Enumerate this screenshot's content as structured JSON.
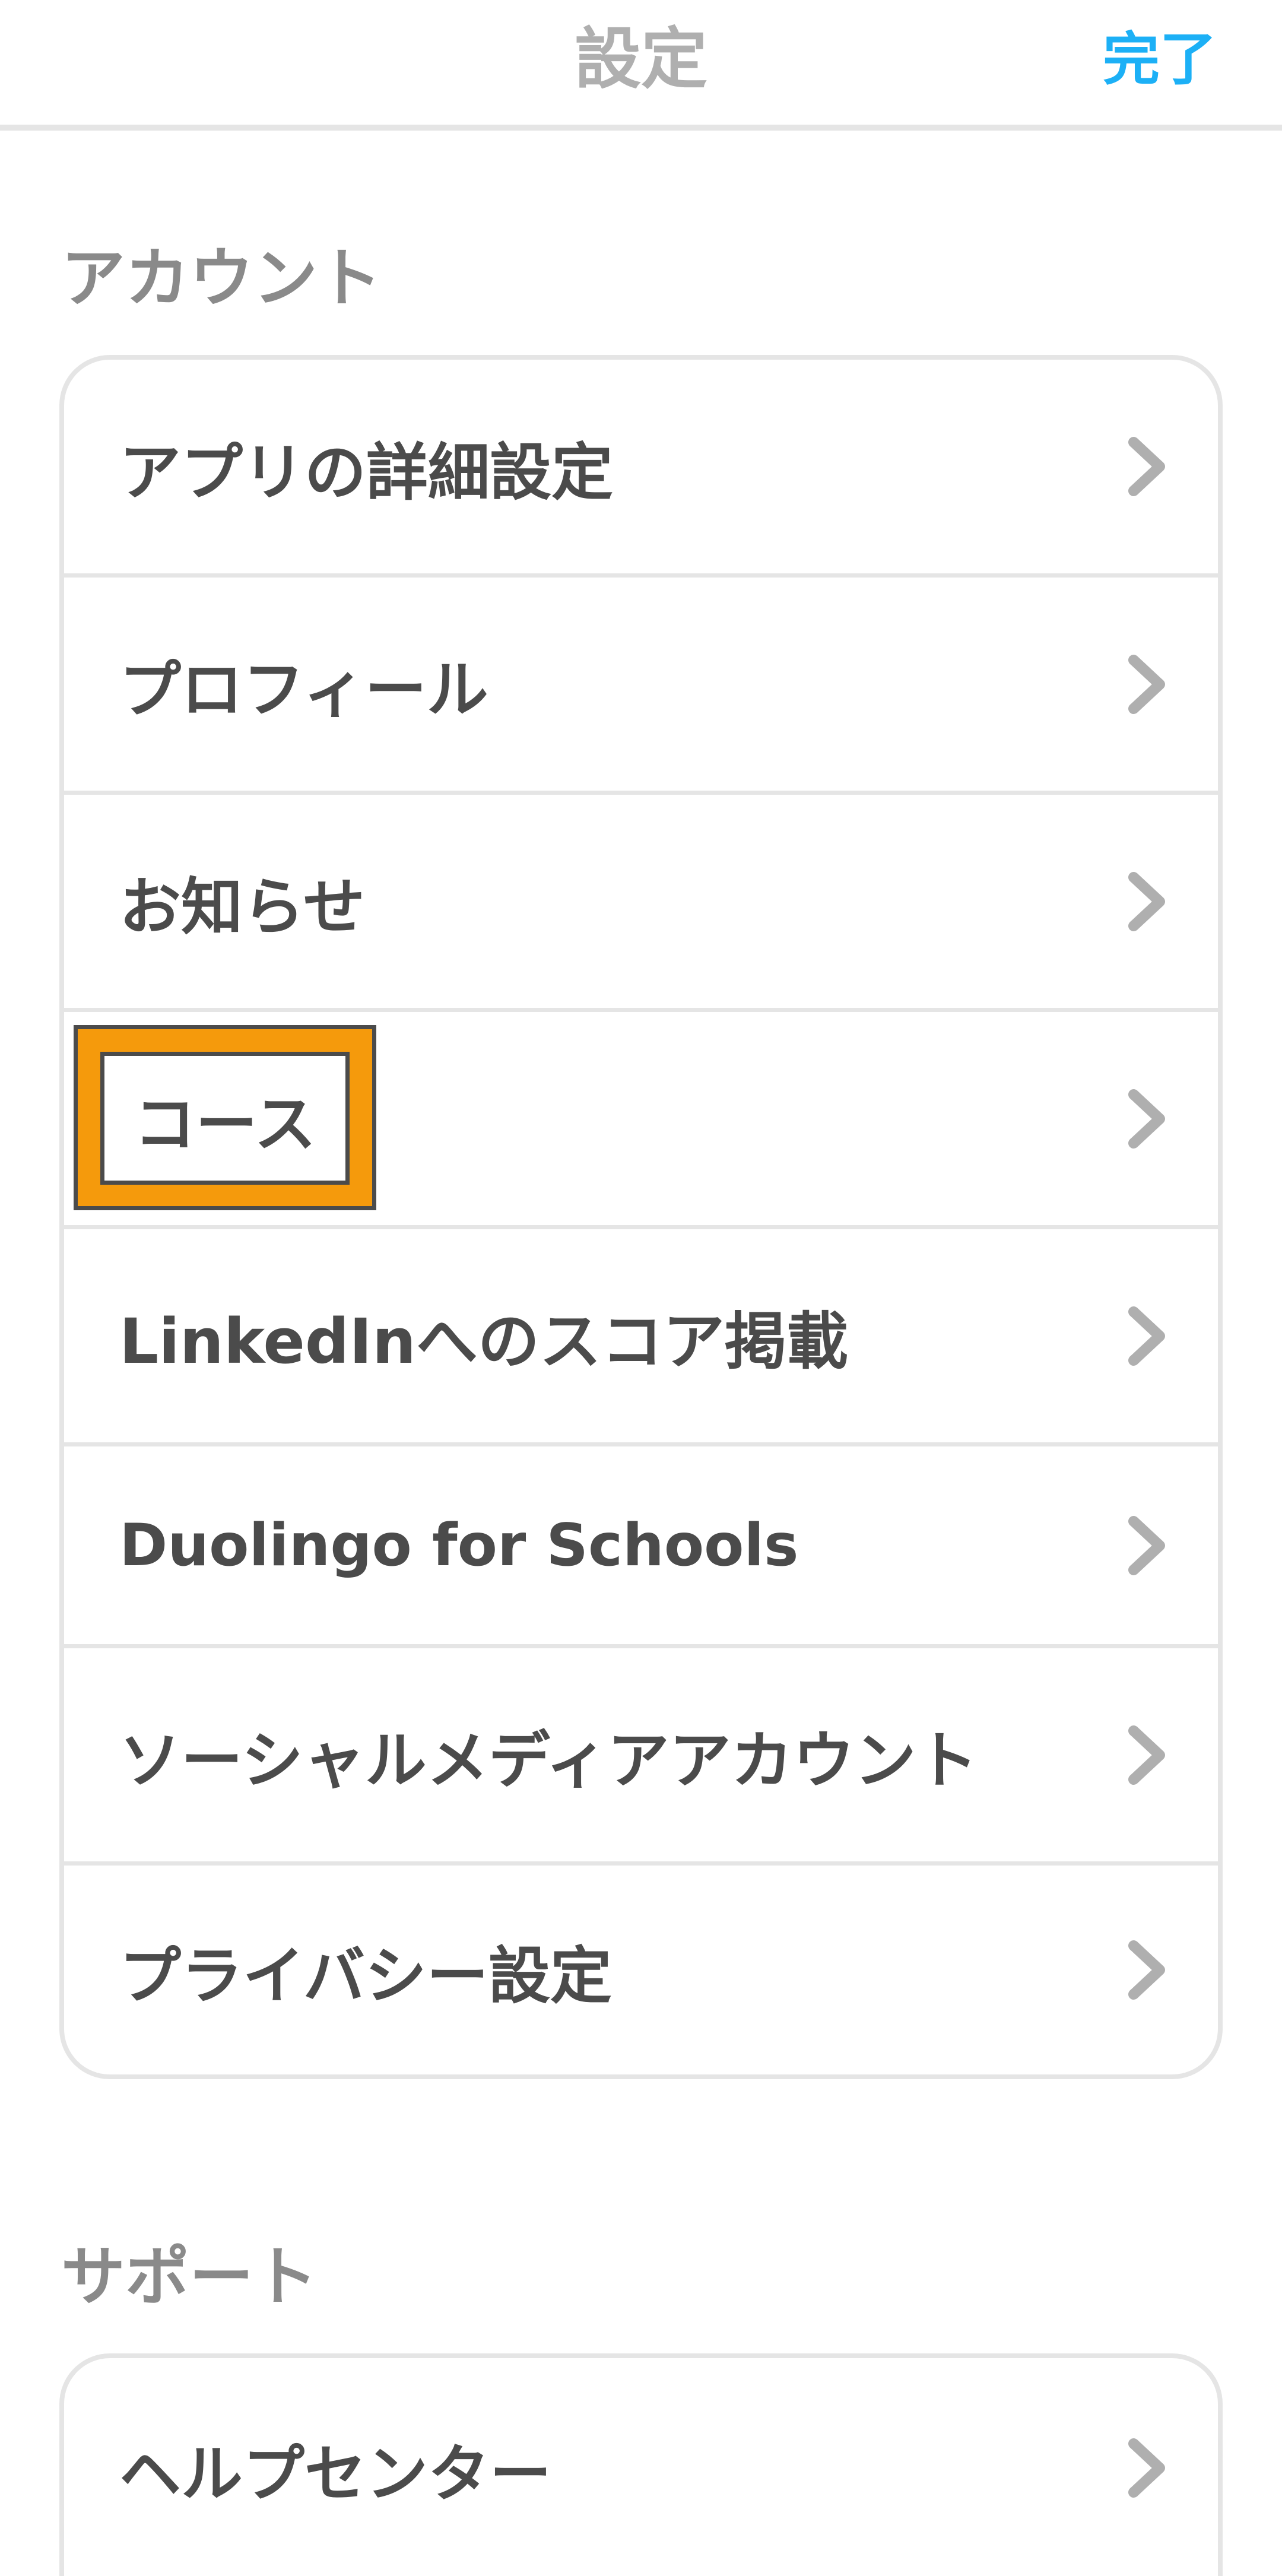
{
  "header": {
    "title": "設定",
    "done_label": "完了",
    "done_color": "#1cb0f6"
  },
  "account_section": {
    "heading": "アカウント",
    "items": [
      {
        "label": "アプリの詳細設定",
        "icon": "chevron-right-icon"
      },
      {
        "label": "プロフィール",
        "icon": "chevron-right-icon"
      },
      {
        "label": "お知らせ",
        "icon": "chevron-right-icon"
      },
      {
        "label": "コース",
        "icon": "chevron-right-icon",
        "highlighted": true
      },
      {
        "label": "LinkedInへのスコア掲載",
        "icon": "chevron-right-icon"
      },
      {
        "label": "Duolingo for Schools",
        "icon": "chevron-right-icon"
      },
      {
        "label": "ソーシャルメディアアカウント",
        "icon": "chevron-right-icon"
      },
      {
        "label": "プライバシー設定",
        "icon": "chevron-right-icon"
      }
    ]
  },
  "support_section": {
    "heading": "サポート",
    "items": [
      {
        "label": "ヘルプセンター",
        "icon": "chevron-right-icon"
      }
    ]
  },
  "colors": {
    "highlight": "#f59a0c",
    "text": "#4b4b4b",
    "border": "#e5e5e5",
    "heading": "#8a8a8a"
  }
}
